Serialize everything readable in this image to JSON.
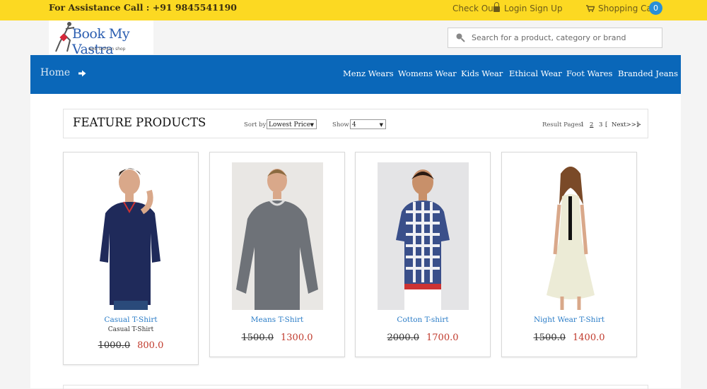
{
  "topbar": {
    "assistance": "For Assistance Call : +91 9845541190",
    "checkout": "Check Out",
    "login": "Login Sign Up",
    "cart": "Shopping Cart",
    "cart_count": "0",
    "lock_icon": "lock-icon",
    "cart_icon": "cart-icon"
  },
  "header": {
    "logo_text": "Book My Vastra",
    "logo_sub": "web fashion shop",
    "search_placeholder": "Search for a product, category or brand",
    "search_icon": "search-icon"
  },
  "nav": {
    "home": "Home",
    "items": [
      "Menz Wears",
      "Womens Wear",
      "Kids Wear",
      "Ethical Wear",
      "Foot Wares",
      "Branded Jeans"
    ]
  },
  "toolbar": {
    "title": "FEATURE PRODUCTS",
    "sort_label": "Sort by:",
    "sort_value": "Lowest Price",
    "show_label": "Show:",
    "show_value": "4",
    "result_pages_label": "Result Pages:",
    "pages": [
      "1",
      "2",
      "3"
    ],
    "bracket_open": "[",
    "next": "Next>>>",
    "bracket_close": "]"
  },
  "products": [
    {
      "name": "Casual T-Shirt",
      "subtitle": "Casual T-Shirt",
      "old_price": "1000.0",
      "new_price": "800.0"
    },
    {
      "name": "Means T-Shirt",
      "subtitle": "",
      "old_price": "1500.0",
      "new_price": "1300.0"
    },
    {
      "name": "Cotton T-shirt",
      "subtitle": "",
      "old_price": "2000.0",
      "new_price": "1700.0"
    },
    {
      "name": "Night Wear T-Shirt",
      "subtitle": "",
      "old_price": "1500.0",
      "new_price": "1400.0"
    }
  ],
  "colors": {
    "topbar": "#fcd922",
    "nav": "#0a67b9",
    "cart_badge": "#2a8fd6",
    "product_link": "#2a7cc7",
    "new_price": "#c0392b"
  }
}
